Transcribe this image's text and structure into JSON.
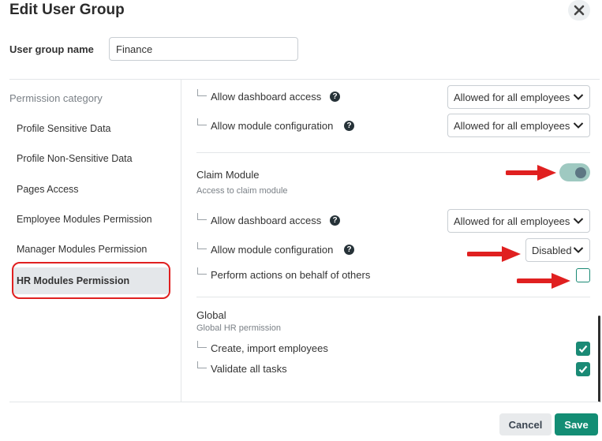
{
  "dialog": {
    "title": "Edit User Group",
    "close_icon": "close-icon"
  },
  "group_name": {
    "label": "User group name",
    "value": "Finance"
  },
  "categories": {
    "header": "Permission category",
    "items": [
      {
        "label": "Profile Sensitive Data"
      },
      {
        "label": "Profile Non-Sensitive Data"
      },
      {
        "label": "Pages Access"
      },
      {
        "label": "Employee Modules Permission"
      },
      {
        "label": "Manager Modules Permission"
      },
      {
        "label": "HR Modules Permission",
        "active": true
      }
    ]
  },
  "top_module": {
    "permissions": [
      {
        "label": "Allow dashboard access",
        "help": true,
        "value": "Allowed for all employees"
      },
      {
        "label": "Allow module configuration",
        "help": true,
        "value": "Allowed for all employees"
      }
    ]
  },
  "claim_module": {
    "title": "Claim Module",
    "subtitle": "Access to claim module",
    "enabled": true,
    "permissions": [
      {
        "label": "Allow dashboard access",
        "help": true,
        "value": "Allowed for all employees"
      },
      {
        "label": "Allow module configuration",
        "help": true,
        "value": "Disabled"
      },
      {
        "label": "Perform actions on behalf of others",
        "checked": false
      }
    ]
  },
  "global": {
    "title": "Global",
    "subtitle": "Global HR permission",
    "permissions": [
      {
        "label": "Create, import employees",
        "checked": true
      },
      {
        "label": "Validate all tasks",
        "checked": true
      }
    ]
  },
  "footer": {
    "cancel_label": "Cancel",
    "save_label": "Save"
  },
  "colors": {
    "accent": "#138d74",
    "annotation_red": "#e02020",
    "toggle_track": "#9fc9c1"
  }
}
